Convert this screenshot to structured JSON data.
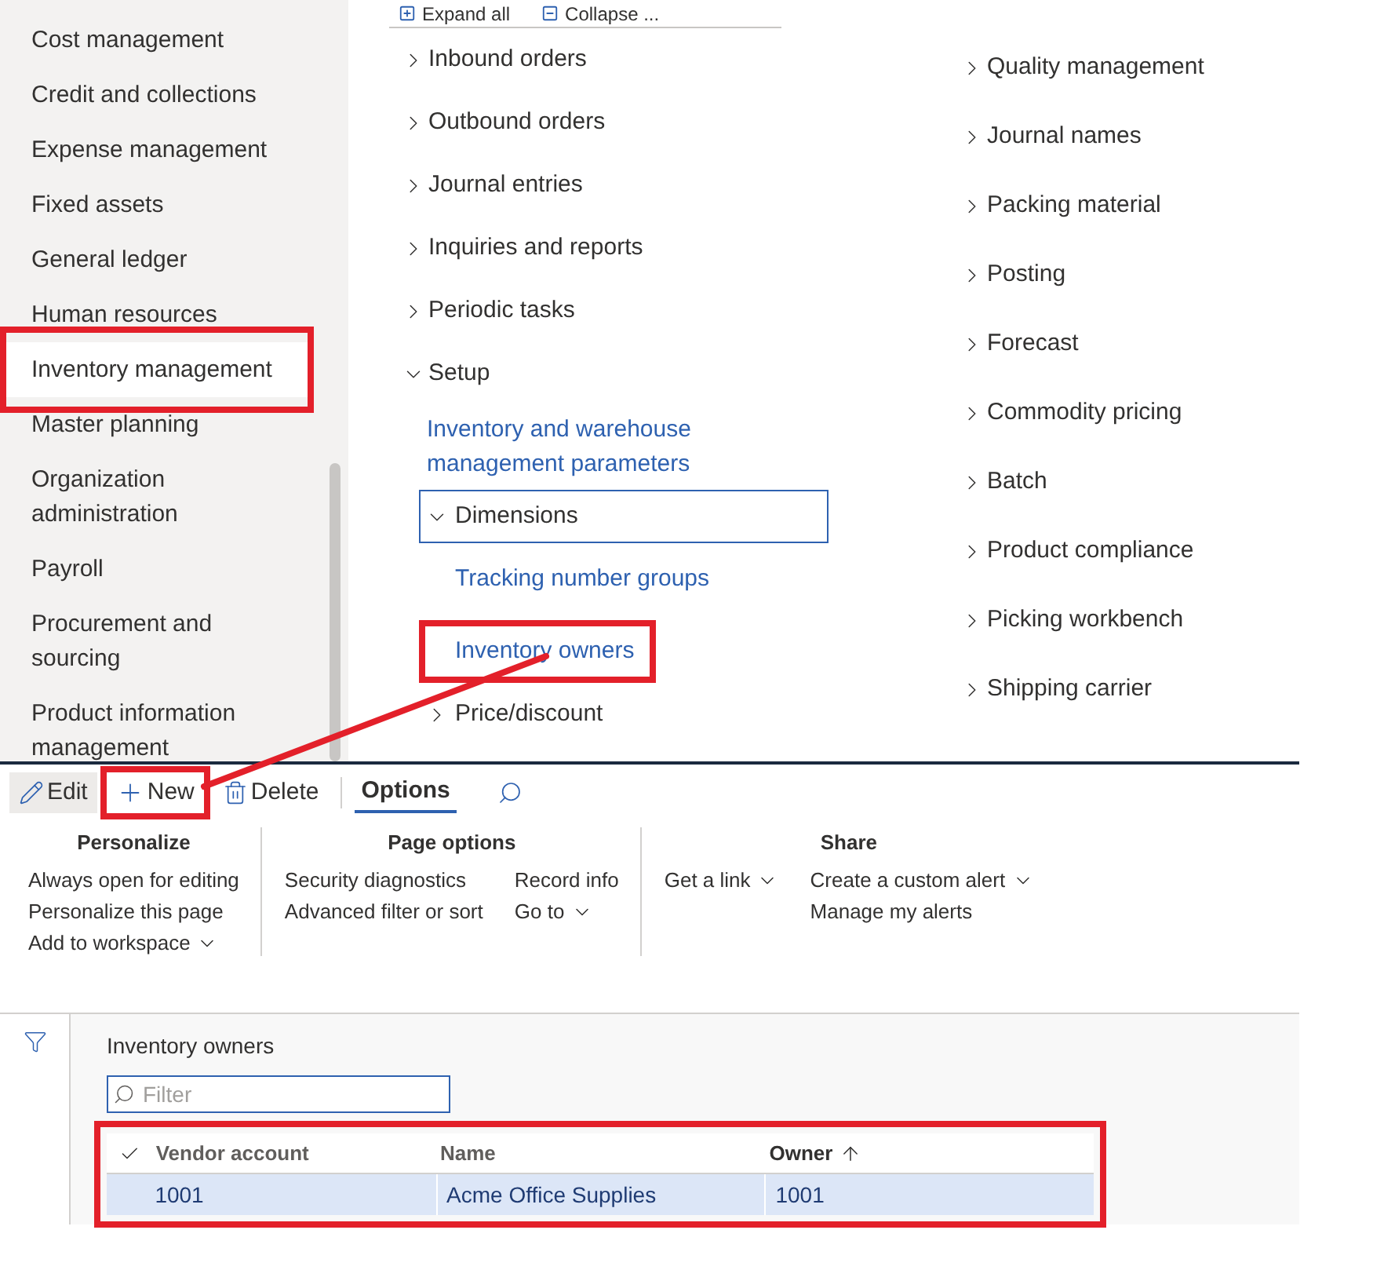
{
  "toolbar": [
    {
      "label": "Expand all",
      "kind": "expand"
    },
    {
      "label": "Collapse ...",
      "kind": "collapse"
    }
  ],
  "sidebar": {
    "items": [
      {
        "label": "Cost management",
        "selected": false,
        "highlighted": false
      },
      {
        "label": "Credit and collections",
        "selected": false,
        "highlighted": false
      },
      {
        "label": "Expense management",
        "selected": false,
        "highlighted": false
      },
      {
        "label": "Fixed assets",
        "selected": false,
        "highlighted": false
      },
      {
        "label": "General ledger",
        "selected": false,
        "highlighted": false
      },
      {
        "label": "Human resources",
        "selected": false,
        "highlighted": false
      },
      {
        "label": "Inventory management",
        "selected": true,
        "highlighted": true
      },
      {
        "label": "Master planning",
        "selected": false,
        "highlighted": false
      },
      {
        "label": "Organization administration",
        "selected": false,
        "highlighted": false
      },
      {
        "label": "Payroll",
        "selected": false,
        "highlighted": false
      },
      {
        "label": "Procurement and sourcing",
        "selected": false,
        "highlighted": false
      },
      {
        "label": "Product information management",
        "selected": false,
        "highlighted": false
      }
    ]
  },
  "menu_left": [
    {
      "label": "Inbound orders",
      "expanded": false
    },
    {
      "label": "Outbound orders",
      "expanded": false
    },
    {
      "label": "Journal entries",
      "expanded": false
    },
    {
      "label": "Inquiries and reports",
      "expanded": false
    },
    {
      "label": "Periodic tasks",
      "expanded": false
    },
    {
      "label": "Setup",
      "expanded": true,
      "children": [
        {
          "kind": "link",
          "label": "Inventory and warehouse management parameters",
          "highlighted": false
        },
        {
          "kind": "group",
          "label": "Dimensions",
          "expanded": true,
          "focused": true,
          "children": [
            {
              "kind": "link",
              "label": "Tracking number groups",
              "highlighted": false
            },
            {
              "kind": "link",
              "label": "Inventory owners",
              "highlighted": true
            }
          ]
        },
        {
          "kind": "group",
          "label": "Price/discount",
          "expanded": false,
          "focused": false
        }
      ]
    }
  ],
  "menu_right": [
    {
      "label": "Quality management",
      "expanded": false
    },
    {
      "label": "Journal names",
      "expanded": false
    },
    {
      "label": "Packing material",
      "expanded": false
    },
    {
      "label": "Posting",
      "expanded": false
    },
    {
      "label": "Forecast",
      "expanded": false
    },
    {
      "label": "Commodity pricing",
      "expanded": false
    },
    {
      "label": "Batch",
      "expanded": false
    },
    {
      "label": "Product compliance",
      "expanded": false
    },
    {
      "label": "Picking workbench",
      "expanded": false
    },
    {
      "label": "Shipping carrier",
      "expanded": false
    }
  ],
  "action_pane": {
    "buttons": [
      {
        "label": "Edit",
        "kind": "edit",
        "pressed": true,
        "highlighted": false
      },
      {
        "label": "New",
        "kind": "new",
        "pressed": false,
        "highlighted": true
      },
      {
        "label": "Delete",
        "kind": "delete",
        "pressed": false,
        "highlighted": false
      }
    ],
    "tabs": [
      {
        "label": "Options",
        "selected": true
      }
    ],
    "groups": [
      {
        "title": "Personalize",
        "columns": [
          [
            {
              "label": "Always open for editing",
              "dropdown": false
            },
            {
              "label": "Personalize this page",
              "dropdown": false
            },
            {
              "label": "Add to workspace",
              "dropdown": true
            }
          ]
        ]
      },
      {
        "title": "Page options",
        "columns": [
          [
            {
              "label": "Security diagnostics",
              "dropdown": false
            },
            {
              "label": "Advanced filter or sort",
              "dropdown": false
            }
          ],
          [
            {
              "label": "Record info",
              "dropdown": false
            },
            {
              "label": "Go to",
              "dropdown": true
            }
          ]
        ]
      },
      {
        "title": "Share",
        "columns": [
          [
            {
              "label": "Get a link",
              "dropdown": true
            }
          ],
          [
            {
              "label": "Create a custom alert",
              "dropdown": true
            },
            {
              "label": "Manage my alerts",
              "dropdown": false
            }
          ]
        ]
      }
    ]
  },
  "grid_panel": {
    "title": "Inventory owners",
    "filter": {
      "placeholder": "Filter"
    },
    "highlighted": true,
    "columns": [
      {
        "label": "Vendor account",
        "sorted": false
      },
      {
        "label": "Name",
        "sorted": false
      },
      {
        "label": "Owner",
        "sorted": true
      }
    ],
    "rows": [
      {
        "cells": [
          "1001",
          "Acme Office Supplies",
          "1001"
        ],
        "selected": true
      }
    ]
  }
}
